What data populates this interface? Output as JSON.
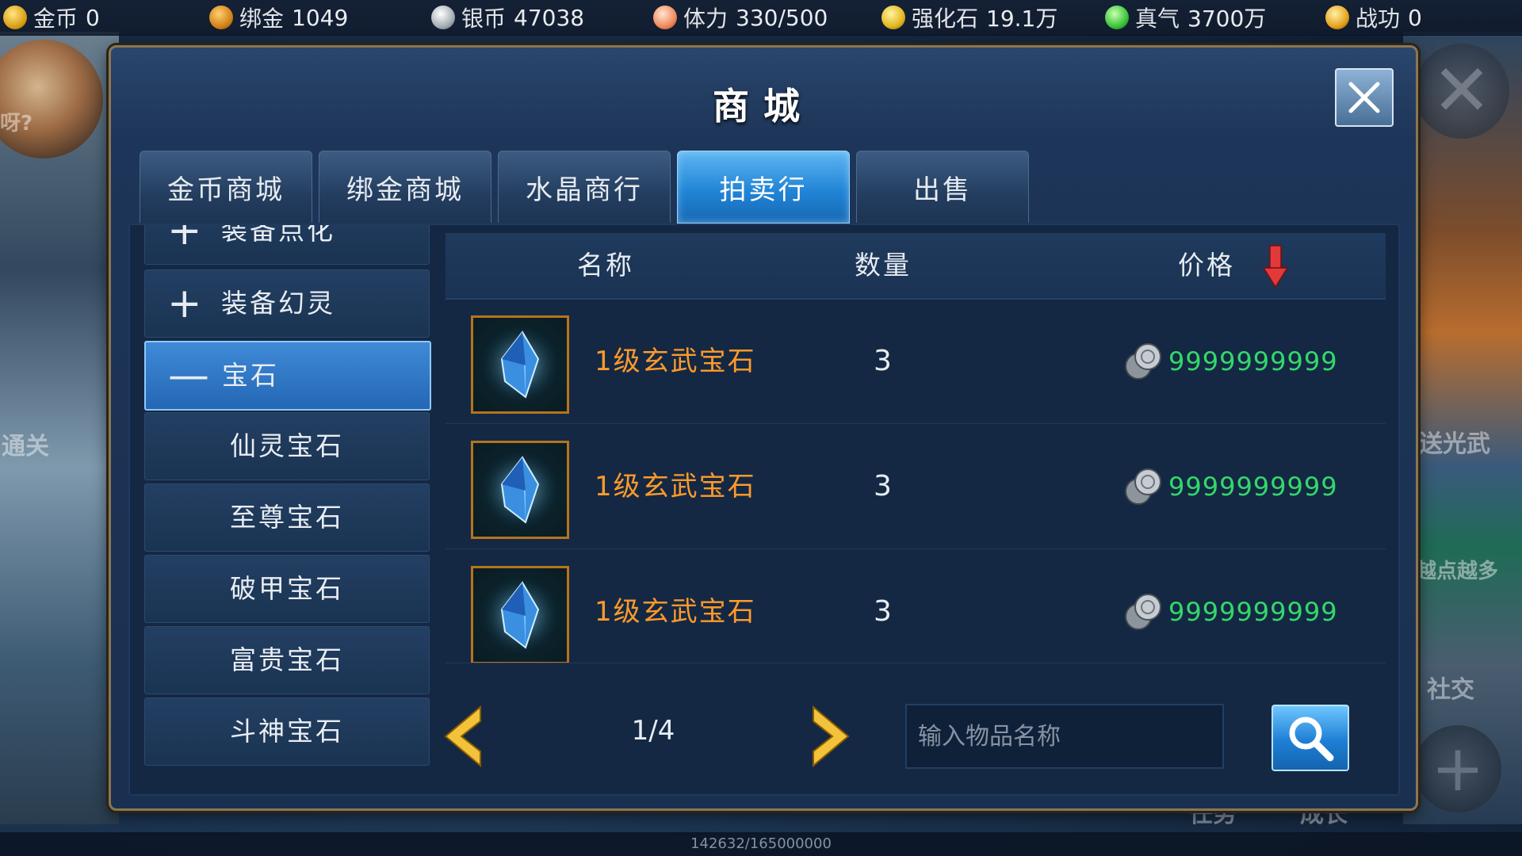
{
  "resources": [
    {
      "icon": "gold-coin-icon",
      "label": "金币",
      "value": "0"
    },
    {
      "icon": "bound-gold-icon",
      "label": "绑金",
      "value": "1049"
    },
    {
      "icon": "silver-coin-icon",
      "label": "银币",
      "value": "47038"
    },
    {
      "icon": "stamina-icon",
      "label": "体力",
      "value": "330/500"
    },
    {
      "icon": "strengthen-stone-icon",
      "label": "强化石",
      "value": "19.1万"
    },
    {
      "icon": "true-qi-icon",
      "label": "真气",
      "value": "3700万"
    },
    {
      "icon": "merit-trophy-icon",
      "label": "战功",
      "value": "0"
    }
  ],
  "background": {
    "left_texts": [
      "呀?",
      "通关"
    ],
    "right_texts": [
      "送光武",
      "越点越多",
      "社交"
    ],
    "bottom_texts": [
      "任务",
      "成长"
    ],
    "exp_text": "142632/165000000"
  },
  "dialog": {
    "title": "商城",
    "close_label": "×"
  },
  "tabs": [
    {
      "label": "金币商城",
      "active": false
    },
    {
      "label": "绑金商城",
      "active": false
    },
    {
      "label": "水晶商行",
      "active": false
    },
    {
      "label": "拍卖行",
      "active": true
    },
    {
      "label": "出售",
      "active": false
    }
  ],
  "categories": [
    {
      "symbol": "+",
      "label": "装备点化",
      "type": "group"
    },
    {
      "symbol": "+",
      "label": "装备幻灵",
      "type": "group"
    },
    {
      "symbol": "—",
      "label": "宝石",
      "type": "group",
      "active": true
    },
    {
      "label": "仙灵宝石",
      "type": "sub"
    },
    {
      "label": "至尊宝石",
      "type": "sub"
    },
    {
      "label": "破甲宝石",
      "type": "sub"
    },
    {
      "label": "富贵宝石",
      "type": "sub"
    },
    {
      "label": "斗神宝石",
      "type": "sub"
    }
  ],
  "table": {
    "headers": {
      "name": "名称",
      "quantity": "数量",
      "price": "价格"
    },
    "sort": "price-descending",
    "rows": [
      {
        "icon": "blue-gem-icon",
        "name": "1级玄武宝石",
        "quantity": "3",
        "price": "9999999999"
      },
      {
        "icon": "blue-gem-icon",
        "name": "1级玄武宝石",
        "quantity": "3",
        "price": "9999999999"
      },
      {
        "icon": "blue-gem-icon",
        "name": "1级玄武宝石",
        "quantity": "3",
        "price": "9999999999"
      }
    ]
  },
  "pager": {
    "text": "1/4"
  },
  "search": {
    "placeholder": "输入物品名称",
    "value": ""
  },
  "colors": {
    "item_name": "#ff9a2a",
    "price": "#33d86a",
    "active_tab": "#2285d6",
    "frame_border": "#8a7654"
  }
}
